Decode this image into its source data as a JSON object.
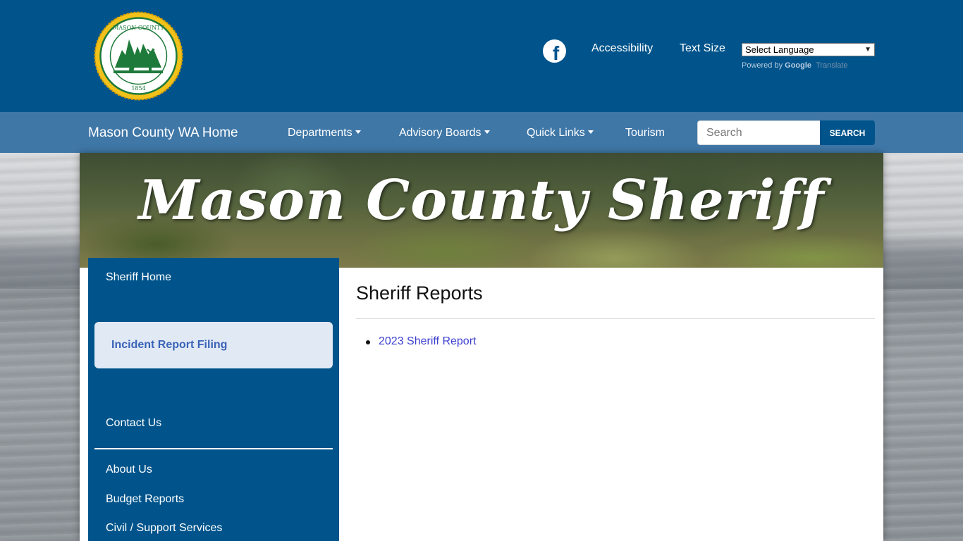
{
  "header": {
    "seal": {
      "top_text": "MASON COUNTY",
      "year": "1854"
    },
    "facebook_icon": "facebook-icon",
    "accessibility_label": "Accessibility",
    "text_size_label": "Text Size",
    "language_select": {
      "selected": "Select Language"
    },
    "powered_by": {
      "prefix": "Powered by",
      "brand": "Google",
      "suffix": "Translate"
    }
  },
  "navbar": {
    "brand": "Mason County WA Home",
    "items": [
      {
        "label": "Departments",
        "dropdown": true
      },
      {
        "label": "Advisory Boards",
        "dropdown": true
      },
      {
        "label": "Quick Links",
        "dropdown": true
      },
      {
        "label": "Tourism",
        "dropdown": false
      }
    ],
    "search": {
      "placeholder": "Search",
      "button_label": "SEARCH"
    }
  },
  "banner": {
    "title": "Mason County Sheriff"
  },
  "sidebar": {
    "items": [
      {
        "label": "Sheriff Home"
      },
      {
        "label": "Incident Report Filing",
        "active": true
      },
      {
        "label": "Contact Us"
      },
      {
        "label": "About Us"
      },
      {
        "label": "Budget Reports"
      },
      {
        "label": "Civil / Support Services"
      }
    ]
  },
  "main": {
    "title": "Sheriff Reports",
    "reports": [
      {
        "label": "2023 Sheriff Report"
      }
    ]
  },
  "colors": {
    "header_blue": "#00548b",
    "nav_blue": "#3f77a7",
    "active_item_bg": "#e1e9f5",
    "link": "#3b3fcf",
    "seal_gold": "#f2c21b",
    "seal_green": "#1e7a3a"
  }
}
